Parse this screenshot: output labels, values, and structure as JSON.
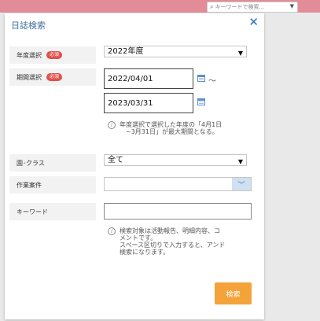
{
  "top_search": {
    "placeholder": "キーワードで検索..."
  },
  "dialog": {
    "title": "日誌検索",
    "close": "✕",
    "required_badge": "必須",
    "fiscal_year": {
      "label": "年度選択",
      "value": "2022年度"
    },
    "period": {
      "label": "期間選択",
      "start": "2022/04/01",
      "end": "2023/03/31",
      "separator": "～",
      "note_line1": "年度選択で選択した年度の「4月1日",
      "note_line2": "~3月31日」が最大期間となる。"
    },
    "class": {
      "label": "園･クラス",
      "value": "全て"
    },
    "work_item": {
      "label": "作業案件",
      "value": ""
    },
    "keyword": {
      "label": "キーワード",
      "value": "",
      "note_line1": "検索対象は活動報告、明細内容、コ",
      "note_line2": "メントです。",
      "note_line3": "スペース区切りで入力すると、アンド",
      "note_line4": "検索になります。"
    },
    "search_button": "検索"
  }
}
